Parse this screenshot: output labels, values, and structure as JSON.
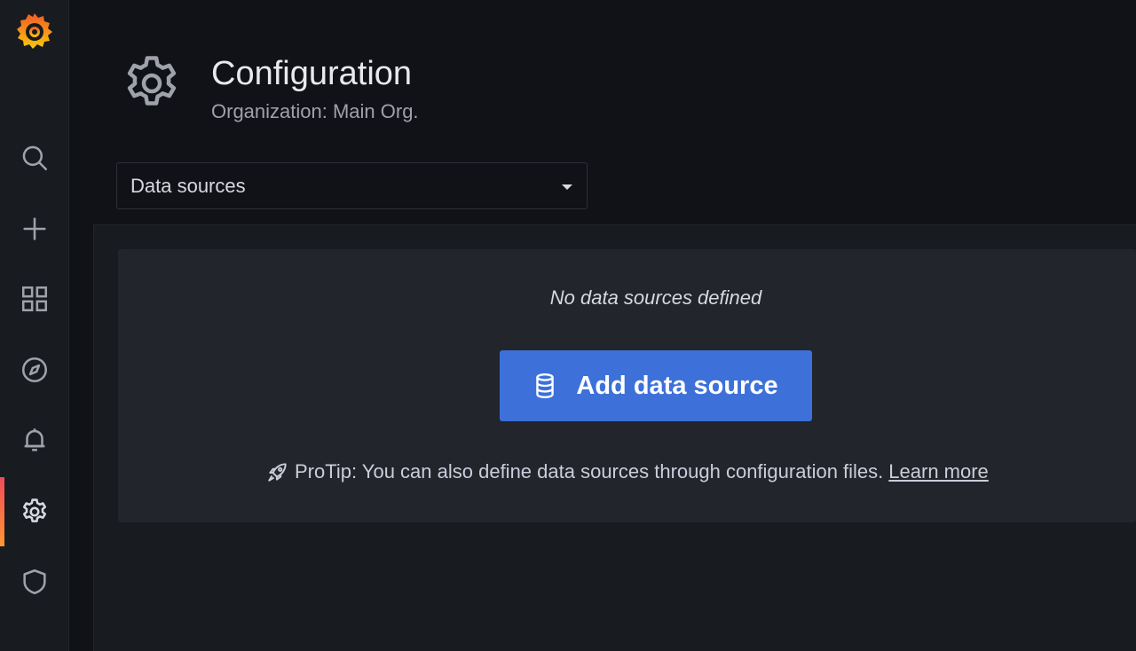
{
  "sidebar": {
    "items": [
      {
        "icon": "search-icon"
      },
      {
        "icon": "plus-icon"
      },
      {
        "icon": "dashboards-icon"
      },
      {
        "icon": "explore-compass-icon"
      },
      {
        "icon": "alerting-bell-icon"
      },
      {
        "icon": "gear-icon",
        "active": true
      },
      {
        "icon": "shield-icon"
      }
    ]
  },
  "header": {
    "title": "Configuration",
    "subtitle": "Organization: Main Org."
  },
  "nav_select": {
    "value": "Data sources"
  },
  "empty_state": {
    "message": "No data sources defined",
    "button_label": "Add data source",
    "protip": "ProTip: You can also define data sources through configuration files.",
    "learn_more": "Learn more"
  },
  "colors": {
    "primary": "#3d71d9",
    "active_accent": "#ff9830",
    "background": "#111217"
  }
}
